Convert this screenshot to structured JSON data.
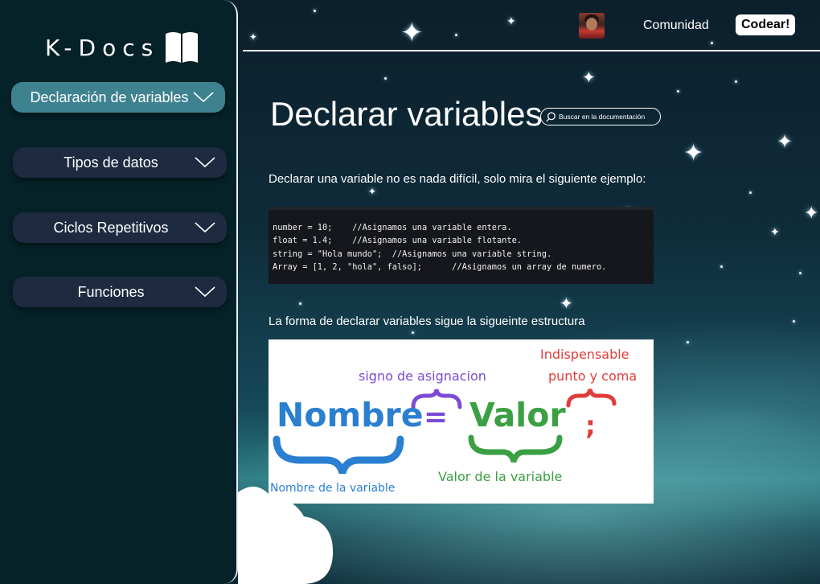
{
  "brand": {
    "name": "K-Docs"
  },
  "sidebar": {
    "items": [
      {
        "label": "Declaración de variables",
        "active": true
      },
      {
        "label": "Tipos de datos",
        "active": false
      },
      {
        "label": "Ciclos Repetitivos",
        "active": false
      },
      {
        "label": "Funciones",
        "active": false
      }
    ]
  },
  "header": {
    "community": "Comunidad",
    "code_button": "Codear!"
  },
  "main": {
    "title": "Declarar variables",
    "search_placeholder": "Buscar en la documentación",
    "intro": "Declarar una variable no es nada difícil, solo mira el siguiente ejemplo:",
    "code": [
      "number = 10;    //Asignamos una variable entera.",
      "float = 1.4;    //Asignamos una variable flotante.",
      "string = \"Hola mundo\";  //Asignamos una variable string.",
      "Array = [1, 2, \"hola\", falso];      //Asignamos un array de numero."
    ],
    "structure_text": "La forma de declarar variables sigue la sigueinte estructura",
    "diagram": {
      "name_word": "Nombre",
      "equals": "=",
      "value_word": "Valor",
      "semicolon": ";",
      "assign_label": "signo de asignacion",
      "indispensable": "Indispensable",
      "semicolon_label": "punto y coma",
      "name_label": "Nombre de la variable",
      "value_label": "Valor de la variable"
    }
  },
  "colors": {
    "sidebar_bg": "#052228",
    "nav_item": "#1d2a3f",
    "nav_active": "#3e8290",
    "diagram_blue": "#2a7fd0",
    "diagram_green": "#3aa043",
    "diagram_purple": "#7b4bd6",
    "diagram_red": "#e03c3c"
  }
}
